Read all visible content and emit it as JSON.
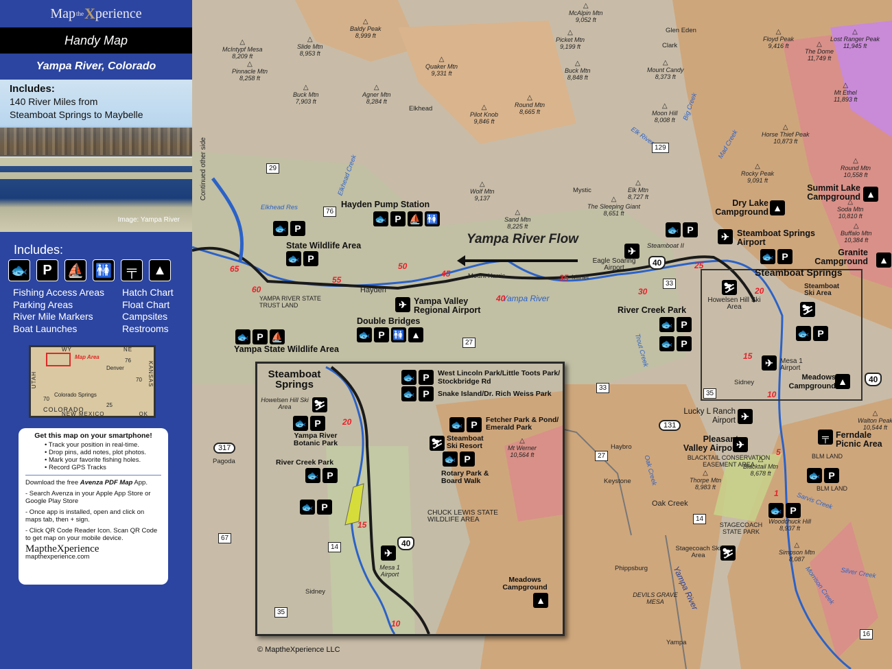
{
  "sidebar": {
    "brand": {
      "left": "Map",
      "mid": "the",
      "right": "perience",
      "x": "X"
    },
    "handy_map": "Handy Map",
    "region": "Yampa River, Colorado",
    "photo": {
      "includes_title": "Includes:",
      "includes_line1": "140 River Miles from",
      "includes_line2": "Steamboat Springs to Maybelle",
      "caption": "Image: Yampa River"
    },
    "includes_title": "Includes:",
    "icons": [
      {
        "name": "fishing-icon",
        "glyph": "🐟"
      },
      {
        "name": "parking-icon",
        "glyph": "P"
      },
      {
        "name": "boat-launch-icon",
        "glyph": "⛵"
      },
      {
        "name": "restroom-icon",
        "glyph": "🚻"
      },
      {
        "name": "picnic-icon",
        "glyph": "╤"
      },
      {
        "name": "campsite-icon",
        "glyph": "▲"
      }
    ],
    "features_left": [
      "Fishing Access Areas",
      "Parking Areas",
      "River Mile Markers",
      "Boat Launches"
    ],
    "features_right": [
      "Hatch Chart",
      "Float Chart",
      "Campsites",
      "Restrooms"
    ],
    "locator": {
      "wy": "WY",
      "ne": "NE",
      "utah": "UTAH",
      "kansas": "KANSAS",
      "new_mexico": "NEW MEXICO",
      "ok": "OK",
      "colorado": "COLORADO",
      "map_area": "Map Area",
      "denver": "Denver",
      "colorado_springs": "Colorado Springs",
      "i76": "76",
      "i70a": "70",
      "i70b": "70",
      "i25": "25"
    },
    "smartphone": {
      "title": "Get this map on your smartphone!",
      "bullets": [
        "Track your position in real-time.",
        "Drop pins, add notes, plot photos.",
        "Mark your favorite fishing holes.",
        "Record GPS Tracks"
      ],
      "download_pre": "Download the free ",
      "download_app": "Avenza PDF Map",
      "download_post": " App.",
      "step1": "- Search Avenza in your Apple App Store or Google Play Store",
      "step2": "- Once app is installed, open and click on maps tab, then + sign.",
      "step3": "- Click QR Code Reader Icon. Scan QR Code to get map on your mobile device.",
      "logo": "MaptheXperience",
      "url": "mapthexperience.com"
    }
  },
  "map": {
    "peaks": [
      {
        "name": "Baldy Peak",
        "elev": "8,999 ft"
      },
      {
        "name": "McIntурf Mesa",
        "elev": "8,209 ft"
      },
      {
        "name": "Slide Mtn",
        "elev": "8,953 ft"
      },
      {
        "name": "Pinnacle Mtn",
        "elev": "8,258 ft"
      },
      {
        "name": "Buck Mtn",
        "elev": "7,903 ft"
      },
      {
        "name": "Agner Mtn",
        "elev": "8,284 ft"
      },
      {
        "name": "Quaker Mtn",
        "elev": "9,331 ft"
      },
      {
        "name": "McAlpin Mtn",
        "elev": "9,052 ft"
      },
      {
        "name": "Picket Mtn",
        "elev": "9,199 ft"
      },
      {
        "name": "Buck Mtn",
        "elev": "8,848 ft"
      },
      {
        "name": "Round Mtn",
        "elev": "8,665 ft"
      },
      {
        "name": "Pilot Knob",
        "elev": "9,846 ft"
      },
      {
        "name": "Mount Candy",
        "elev": "8,373 ft"
      },
      {
        "name": "Moon Hill",
        "elev": "8,008 ft"
      },
      {
        "name": "Floyd Peak",
        "elev": "9,416 ft"
      },
      {
        "name": "Lost Ranger Peak",
        "elev": "11,945 ft"
      },
      {
        "name": "The Dome",
        "elev": "11,749 ft"
      },
      {
        "name": "Mt Ethel",
        "elev": "11,893 ft"
      },
      {
        "name": "Horse Thief Peak",
        "elev": "10,873 ft"
      },
      {
        "name": "Round Mtn",
        "elev": "10,558 ft"
      },
      {
        "name": "Rocky Peak",
        "elev": "9,091 ft"
      },
      {
        "name": "Soda Mtn",
        "elev": "10,810 ft"
      },
      {
        "name": "Buffalo Mtn",
        "elev": "10,384 ft"
      },
      {
        "name": "Wolf Mtn",
        "elev": "9,137"
      },
      {
        "name": "Sand Mtn",
        "elev": "8,225 ft"
      },
      {
        "name": "Elk Mtn",
        "elev": "8,727 ft"
      },
      {
        "name": "The Sleeping Giant",
        "elev": "8,651 ft"
      },
      {
        "name": "Walton Peak",
        "elev": "10,544 ft"
      },
      {
        "name": "Blacktail Mtn",
        "elev": "8,678 ft"
      },
      {
        "name": "Thorpe Mtn",
        "elev": "8,983 ft"
      },
      {
        "name": "Woodchuck Hill",
        "elev": "8,937 ft"
      },
      {
        "name": "Simpson Mtn",
        "elev": "8,087"
      },
      {
        "name": "Mt Werner",
        "elev": "10,564 ft"
      }
    ],
    "towns": [
      "Elkhead",
      "Glen Eden",
      "Clark",
      "Mystic",
      "Steamboat II",
      "Hayden",
      "Mount Harris",
      "Milner",
      "Sidney",
      "Pagoda",
      "Haybro",
      "Keystone",
      "Oak Creek",
      "Phippsburg",
      "Yampa"
    ],
    "water": [
      "Elkhead Res",
      "Elkhead Creek",
      "Elk River",
      "Big Creek",
      "Mad Creek",
      "Trout Creek",
      "Oak Creek",
      "Sarvis Creek",
      "Silver Creek",
      "Morrison Creek",
      "Yampa River",
      "Yampa River"
    ],
    "continued": "Continued other side",
    "flow_label": "Yampa River Flow",
    "mile_markers": [
      "65",
      "60",
      "55",
      "50",
      "45",
      "40",
      "35",
      "30",
      "25",
      "20",
      "15",
      "10",
      "5",
      "1"
    ],
    "routes": {
      "r29": "29",
      "r76": "76",
      "r27": "27",
      "r33": "33",
      "r129": "129",
      "r35": "35",
      "r131": "131",
      "r317": "317",
      "r67": "67",
      "r14": "14",
      "r16": "16",
      "us40a": "40",
      "us40b": "40",
      "us40c": "40"
    },
    "places": {
      "hayden_pump": "Hayden Pump Station",
      "state_wildlife": "State Wildlife Area",
      "yampa_swa": "Yampa State Wildlife Area",
      "trust_land": "YAMPA RIVER STATE TRUST LAND",
      "double_bridges": "Double Bridges",
      "yv_airport": "Yampa Valley Regional Airport",
      "eagle_airport": "Eagle Soaring Airport",
      "ss_airport": "Steamboat Springs Airport",
      "dry_lake": "Dry Lake Campground",
      "summit_lake": "Summit Lake Campground",
      "granite": "Granite Campground",
      "steamboat": "Steamboat Springs",
      "ss_ski": "Steamboat Ski Area",
      "howelsen": "Howelsen Hill Ski Area",
      "river_creek": "River Creek Park",
      "mesa1": "Mesa 1 Airport",
      "meadows": "Meadows Campground",
      "lucky_l": "Lucky L Ranch Airport",
      "pleasant_valley": "Pleasant Valley Airport",
      "ferndale": "Ferndale Picnic Area",
      "blacktail": "BLACKTAIL CONSERVATION EASEMENT AREA",
      "blm1": "BLM LAND",
      "blm2": "BLM LAND",
      "stagecoach_sp": "STAGECOACH STATE PARK",
      "stagecoach_ski": "Stagecoach Ski Area",
      "devils_grave": "DEVILS GRAVE MESA"
    },
    "inset": {
      "title": "Steamboat Springs",
      "west_lincoln": "West Lincoln Park/Little Toots Park/ Stockbridge Rd",
      "snake_island": "Snake Island/Dr. Rich Weiss Park",
      "howelsen": "Howelsen Hill Ski Area",
      "fetcher": "Fetcher Park & Pond/ Emerald Park",
      "botanic": "Yampa River Botanic Park",
      "ski_resort": "Steamboat Ski Resort",
      "river_creek": "River Creek Park",
      "rotary": "Rotary Park & Board Walk",
      "chuck_lewis": "CHUCK LEWIS STATE WILDLIFE AREA",
      "mesa1": "Mesa 1 Airport",
      "meadows": "Meadows Campground",
      "sidney": "Sidney",
      "mt_werner": "Mt Werner",
      "mt_werner_elev": "10,564 ft",
      "mi20": "20",
      "mi15": "15",
      "mi10": "10",
      "r14": "14",
      "r35": "35",
      "us40": "40"
    },
    "copyright": "© MaptheXperience LLC"
  },
  "colors": {
    "sidebar_blue": "#2c45a0",
    "river": "#2b62c8",
    "mile_marker": "#e8202a"
  }
}
